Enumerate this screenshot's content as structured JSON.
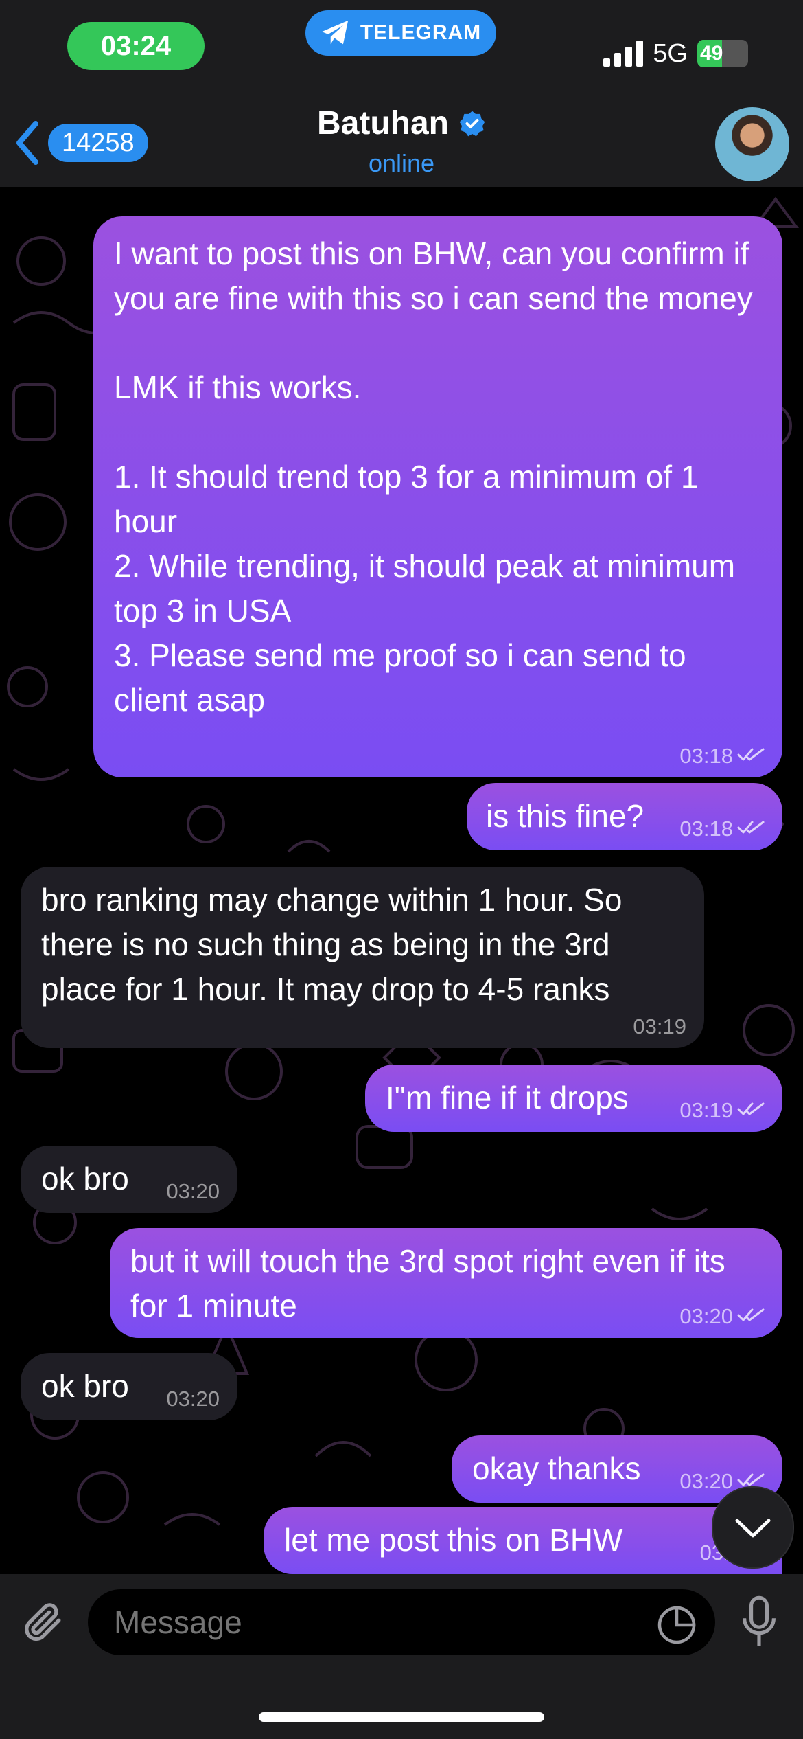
{
  "status_bar": {
    "time": "03:24",
    "app_pill": "TELEGRAM",
    "network": "5G",
    "battery_level": "49",
    "battery_fraction": 0.49
  },
  "header": {
    "back_count": "14258",
    "contact_name": "Batuhan",
    "status": "online",
    "verified": true
  },
  "messages": [
    {
      "direction": "out",
      "text": "I want to post this on BHW, can you confirm if you are fine with this so i can send the money\n\nLMK if this works.\n\n1. It should trend top 3 for a minimum of 1 hour\n2. While trending, it should peak at minimum top 3 in USA\n3. Please send me proof so i can send to client asap",
      "time": "03:18",
      "read": true
    },
    {
      "direction": "out",
      "text": "is this fine?",
      "time": "03:18",
      "read": true
    },
    {
      "direction": "in",
      "text": "bro ranking may change within 1 hour. So there is no such thing as being in the 3rd place for 1 hour. It may drop to 4-5 ranks",
      "time": "03:19"
    },
    {
      "direction": "out",
      "text": "I\"m fine if it drops",
      "time": "03:19",
      "read": true
    },
    {
      "direction": "in",
      "text": "ok bro",
      "time": "03:20"
    },
    {
      "direction": "out",
      "text": "but it will touch the 3rd spot right even if its for 1 minute",
      "time": "03:20",
      "read": true
    },
    {
      "direction": "in",
      "text": "ok bro",
      "time": "03:20"
    },
    {
      "direction": "out",
      "text": "okay thanks",
      "time": "03:20",
      "read": true
    },
    {
      "direction": "out",
      "text": "let me post this on BHW",
      "time": "03:2",
      "read": true
    }
  ],
  "composer": {
    "placeholder": "Message"
  },
  "colors": {
    "accent": "#2a8ef0",
    "outgoing_top": "#9b51e0",
    "outgoing_bottom": "#5b5bf7",
    "incoming": "#1f1e25",
    "status_green": "#34c759"
  },
  "icons": [
    "back-chevron-icon",
    "telegram-plane-icon",
    "verified-badge-icon",
    "signal-icon",
    "battery-icon",
    "read-check-icon",
    "scroll-down-chevron-icon",
    "attach-paperclip-icon",
    "sticker-icon",
    "microphone-icon"
  ]
}
